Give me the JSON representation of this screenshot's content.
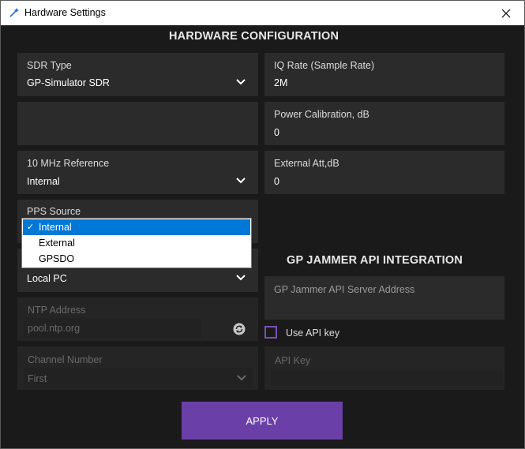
{
  "window": {
    "title": "Hardware Settings"
  },
  "hardware": {
    "heading": "HARDWARE CONFIGURATION",
    "sdr_type": {
      "label": "SDR Type",
      "value": "GP-Simulator SDR"
    },
    "iq_rate": {
      "label": "IQ Rate (Sample Rate)",
      "value": "2M"
    },
    "power_calibration": {
      "label": "Power Calibration, dB",
      "value": "0"
    },
    "reference": {
      "label": "10 MHz Reference",
      "value": "Internal"
    },
    "external_att": {
      "label": "External Att,dB",
      "value": "0"
    },
    "pps_source": {
      "label": "PPS Source",
      "options": [
        "Internal",
        "External",
        "GPSDO"
      ],
      "selected": "Internal"
    },
    "time_source": {
      "value": "Local PC"
    },
    "ntp": {
      "label": "NTP Address",
      "value": "pool.ntp.org"
    },
    "channel": {
      "label": "Channel Number",
      "value": "First"
    }
  },
  "jammer": {
    "heading": "GP JAMMER API INTEGRATION",
    "server_address": {
      "label": "GP Jammer API Server Address",
      "value": ""
    },
    "use_api_key": {
      "label": "Use API key",
      "checked": false
    },
    "api_key": {
      "label": "API Key",
      "value": ""
    }
  },
  "actions": {
    "apply_label": "APPLY"
  },
  "colors": {
    "accent": "#6b3fa8",
    "card": "#2b2b2b",
    "background": "#1a1a1a",
    "selection": "#0078d7"
  },
  "icons": {
    "app": "wand-icon",
    "close": "close-icon",
    "chevron": "chevron-down-icon",
    "refresh": "refresh-icon",
    "check": "check-icon"
  }
}
